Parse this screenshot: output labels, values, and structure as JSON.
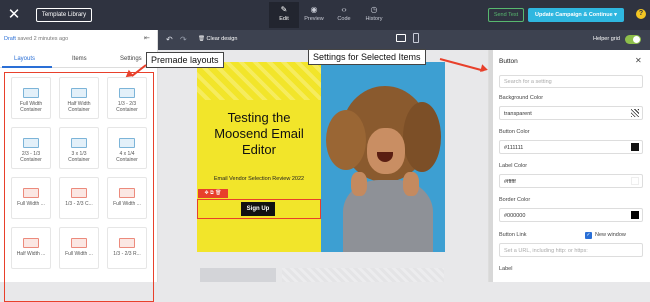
{
  "topbar": {
    "template_library": "Template Library",
    "modes": [
      {
        "label": "Edit",
        "icon": "pencil-icon"
      },
      {
        "label": "Preview",
        "icon": "eye-icon"
      },
      {
        "label": "Code",
        "icon": "code-icon"
      },
      {
        "label": "History",
        "icon": "clock-icon"
      }
    ],
    "send_test": "Send Test",
    "update_campaign": "Update Campaign & Continue",
    "help": "?"
  },
  "left": {
    "draft_label": "Draft",
    "draft_status": "saved 2 minutes ago",
    "tabs": [
      "Layouts",
      "Items",
      "Settings"
    ],
    "tiles": [
      "Full Width Container",
      "Half Width Container",
      "1/3 - 2/3 Container",
      "2/3 - 1/3 Container",
      "3 x 1/3 Container",
      "4 x 1/4 Container",
      "Full Width ...",
      "1/3 - 2/3 C...",
      "Full Width ...",
      "Half Width ...",
      "Full Width ...",
      "1/3 - 2/3 R..."
    ]
  },
  "canvas": {
    "clear_design": "Clear design",
    "helper_grid": "Helper grid",
    "email": {
      "title": "Testing the Moosend Email Editor",
      "subtitle": "Email Vendor Selection Review 2022",
      "button": "Sign Up"
    }
  },
  "callouts": {
    "premade": "Premade layouts",
    "settings": "Settings for Selected Items"
  },
  "right": {
    "title": "Button",
    "search_placeholder": "Search for a setting",
    "fields": [
      {
        "label": "Background Color",
        "value": "transparent",
        "swatch": "transparent"
      },
      {
        "label": "Button Color",
        "value": "#111111",
        "swatch": "#111111"
      },
      {
        "label": "Label Color",
        "value": "#ffffff",
        "swatch": "#ffffff"
      },
      {
        "label": "Border Color",
        "value": "#000000",
        "swatch": "#000000"
      }
    ],
    "link_label": "Button Link",
    "new_window": "New window",
    "link_placeholder": "Set a URL, including http: or https:",
    "label_label": "Label"
  }
}
